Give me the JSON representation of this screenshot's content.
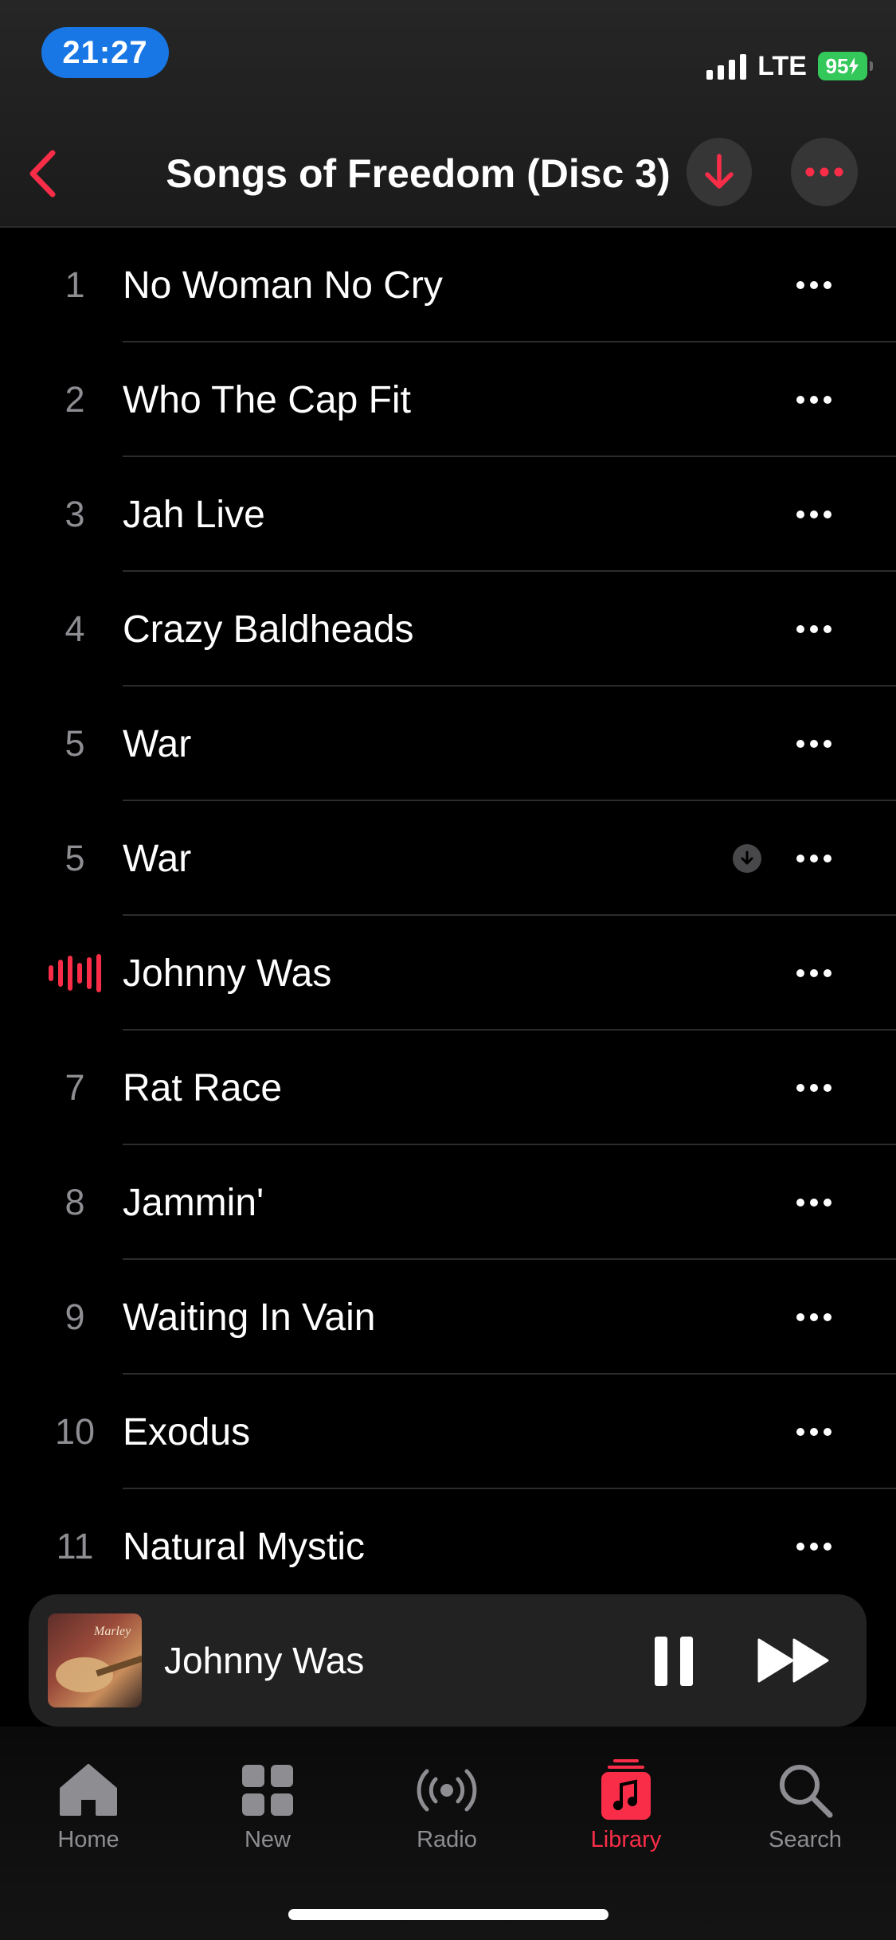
{
  "status_bar": {
    "time": "21:27",
    "network": "LTE",
    "battery": "95"
  },
  "nav": {
    "title": "Songs of Freedom (Disc 3)"
  },
  "tracks": [
    {
      "number": "1",
      "title": "No Woman No Cry"
    },
    {
      "number": "2",
      "title": "Who The Cap Fit"
    },
    {
      "number": "3",
      "title": "Jah Live"
    },
    {
      "number": "4",
      "title": "Crazy Baldheads"
    },
    {
      "number": "5",
      "title": "War"
    },
    {
      "number": "5",
      "title": "War",
      "downloadable": true
    },
    {
      "number": "",
      "title": "Johnny Was",
      "playing": true
    },
    {
      "number": "7",
      "title": "Rat Race"
    },
    {
      "number": "8",
      "title": "Jammin'"
    },
    {
      "number": "9",
      "title": "Waiting In Vain"
    },
    {
      "number": "10",
      "title": "Exodus"
    },
    {
      "number": "11",
      "title": "Natural Mystic"
    }
  ],
  "now_playing": {
    "title": "Johnny Was",
    "artwork_text": "Marley"
  },
  "tabs": [
    {
      "label": "Home",
      "icon": "home-icon"
    },
    {
      "label": "New",
      "icon": "grid-icon"
    },
    {
      "label": "Radio",
      "icon": "radio-icon"
    },
    {
      "label": "Library",
      "icon": "library-icon",
      "active": true
    },
    {
      "label": "Search",
      "icon": "search-icon"
    }
  ],
  "colors": {
    "accent": "#fa2d48",
    "time_pill": "#1877e5",
    "battery": "#34c759"
  }
}
